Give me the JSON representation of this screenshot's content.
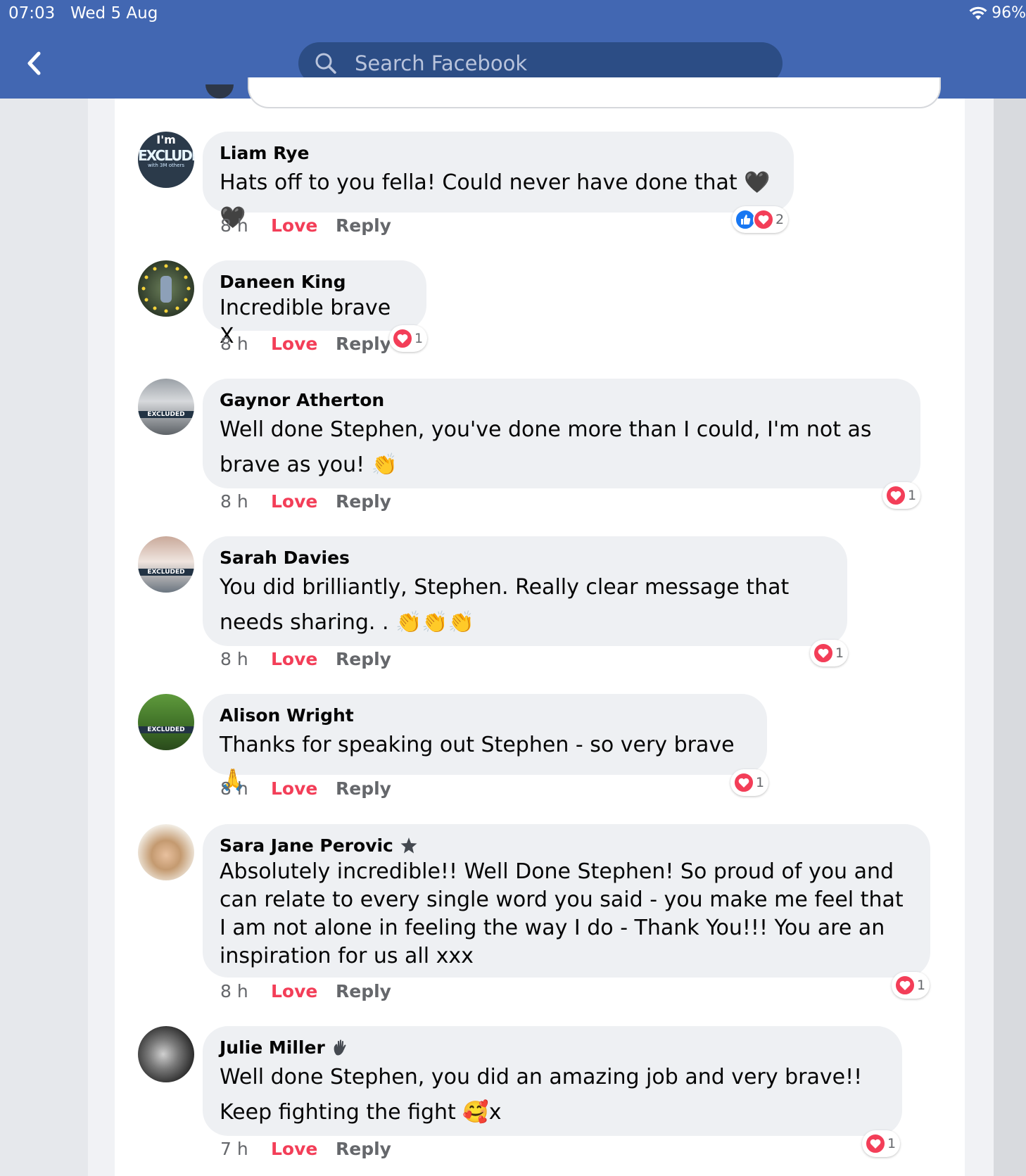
{
  "status_bar": {
    "time": "07:03",
    "date": "Wed 5 Aug",
    "battery": "96%"
  },
  "search": {
    "placeholder": "Search Facebook"
  },
  "actions": {
    "love": "Love",
    "reply": "Reply"
  },
  "colors": {
    "header": "#4267b2",
    "search_bg": "#2c4d85",
    "love": "#f33e58",
    "bubble": "#eef0f3"
  },
  "comments": [
    {
      "name": "Liam Rye",
      "text": "Hats off to you fella! Could never have done that",
      "emoji": "🖤🖤",
      "time": "8 h",
      "reaction_count": "2",
      "avatar_text": "I'm",
      "avatar_text2": "EXCLUDED",
      "avatar_text3": "with 3M others"
    },
    {
      "name": "Daneen King",
      "text": "Incredible  brave X",
      "time": "8 h",
      "reaction_count": "1"
    },
    {
      "name": "Gaynor Atherton",
      "text": "Well done Stephen, you've done more than I could, I'm not as brave as you!",
      "emoji": "👏",
      "time": "8 h",
      "reaction_count": "1",
      "avatar_label": "EXCLUDED"
    },
    {
      "name": "Sarah Davies",
      "text": "You did brilliantly, Stephen. Really clear message that needs sharing. .",
      "emoji": "👏👏👏",
      "time": "8 h",
      "reaction_count": "1",
      "avatar_label": "EXCLUDED"
    },
    {
      "name": "Alison Wright",
      "text": "Thanks for speaking out Stephen - so very brave",
      "emoji": "🙏",
      "time": "8 h",
      "reaction_count": "1",
      "avatar_label": "EXCLUDED"
    },
    {
      "name": "Sara Jane Perovic",
      "text": "Absolutely incredible!! Well Done Stephen! So proud of you and can relate to every single word you said - you make me feel that I am not alone in feeling the way I do - Thank You!!! You are an inspiration for us all xxx",
      "time": "8 h",
      "reaction_count": "1",
      "badge": "star-badge-icon"
    },
    {
      "name": "Julie Miller",
      "text": "Well done Stephen, you did an amazing job and very brave!! Keep fighting the fight",
      "emoji": "🥰",
      "suffix": "x",
      "time": "7 h",
      "reaction_count": "1",
      "badge": "waving-hand-badge-icon"
    }
  ]
}
